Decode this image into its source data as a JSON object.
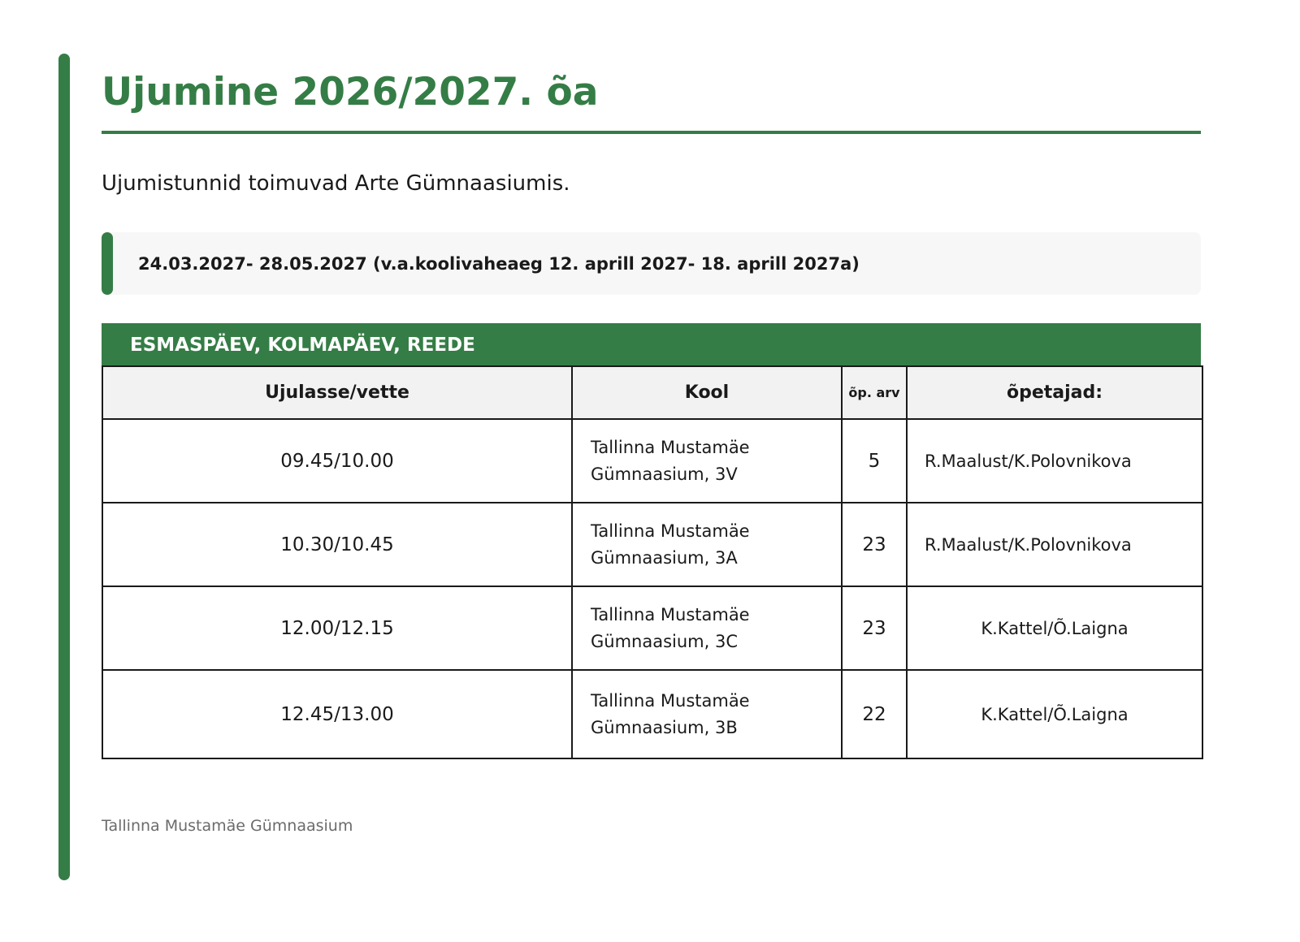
{
  "page": {
    "title": "Ujumine 2026/2027. õa",
    "intro": "Ujumistunnid toimuvad Arte Gümnaasiumis.",
    "period": "24.03.2027- 28.05.2027 (v.a.koolivaheaeg 12. aprill 2027- 18. aprill 2027a)",
    "days": "ESMASPÄEV, KOLMAPÄEV, REEDE",
    "footer": "Tallinna Mustamäe Gümnaasium",
    "accent_color": "#357d46"
  },
  "table": {
    "headers": {
      "time": "Ujulasse/vette",
      "school": "Kool",
      "count": "õp. arv",
      "teachers": "õpetajad:"
    },
    "rows": [
      {
        "time": "09.45/10.00",
        "school_line1": "Tallinna Mustamäe",
        "school_line2": "Gümnaasium, 3V",
        "count": "5",
        "teachers": "R.Maalust/K.Polovnikova"
      },
      {
        "time": "10.30/10.45",
        "school_line1": "Tallinna Mustamäe",
        "school_line2": "Gümnaasium, 3A",
        "count": "23",
        "teachers": "R.Maalust/K.Polovnikova"
      },
      {
        "time": "12.00/12.15",
        "school_line1": "Tallinna Mustamäe",
        "school_line2": "Gümnaasium, 3C",
        "count": "23",
        "teachers": "K.Kattel/Õ.Laigna"
      },
      {
        "time": "12.45/13.00",
        "school_line1": "Tallinna Mustamäe",
        "school_line2": "Gümnaasium, 3B",
        "count": "22",
        "teachers": "K.Kattel/Õ.Laigna"
      }
    ]
  }
}
